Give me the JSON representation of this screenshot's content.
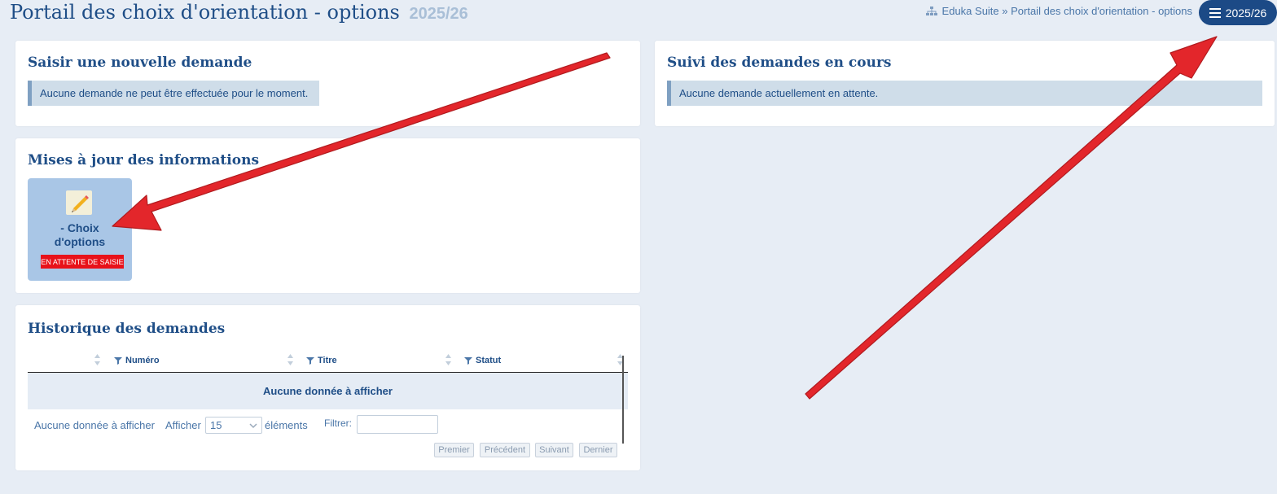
{
  "header": {
    "title": "Portail des choix d'orientation - options",
    "year": "2025/26",
    "breadcrumb": "Eduka Suite » Portail des choix d'orientation - options",
    "year_button": "2025/26"
  },
  "new_request": {
    "title": "Saisir une nouvelle demande",
    "message": "Aucune demande ne peut être effectuée pour le moment."
  },
  "tracking": {
    "title": "Suivi des demandes en cours",
    "message": "Aucune demande actuellement en attente."
  },
  "updates": {
    "title": "Mises à jour des informations",
    "tile": {
      "label_line1": "- Choix",
      "label_line2": "d'options",
      "badge": "EN ATTENTE DE SAISIE",
      "icon": "pencil-edit-icon"
    }
  },
  "history": {
    "title": "Historique des demandes",
    "columns": [
      "Numéro",
      "Titre",
      "Statut"
    ],
    "empty_message": "Aucune donnée à afficher",
    "footer": {
      "info": "Aucune donnée à afficher",
      "show_label": "Afficher",
      "page_size": "15",
      "elements_label": "éléments",
      "filter_label": "Filtrer:",
      "filter_value": ""
    },
    "pagination": {
      "first": "Premier",
      "previous": "Précédent",
      "next": "Suivant",
      "last": "Dernier"
    }
  },
  "colors": {
    "accent": "#1f4e87",
    "background": "#e7edf5",
    "tile": "#a9c6e6",
    "badge": "#e8121a",
    "annotation_arrow": "#e3262b"
  }
}
